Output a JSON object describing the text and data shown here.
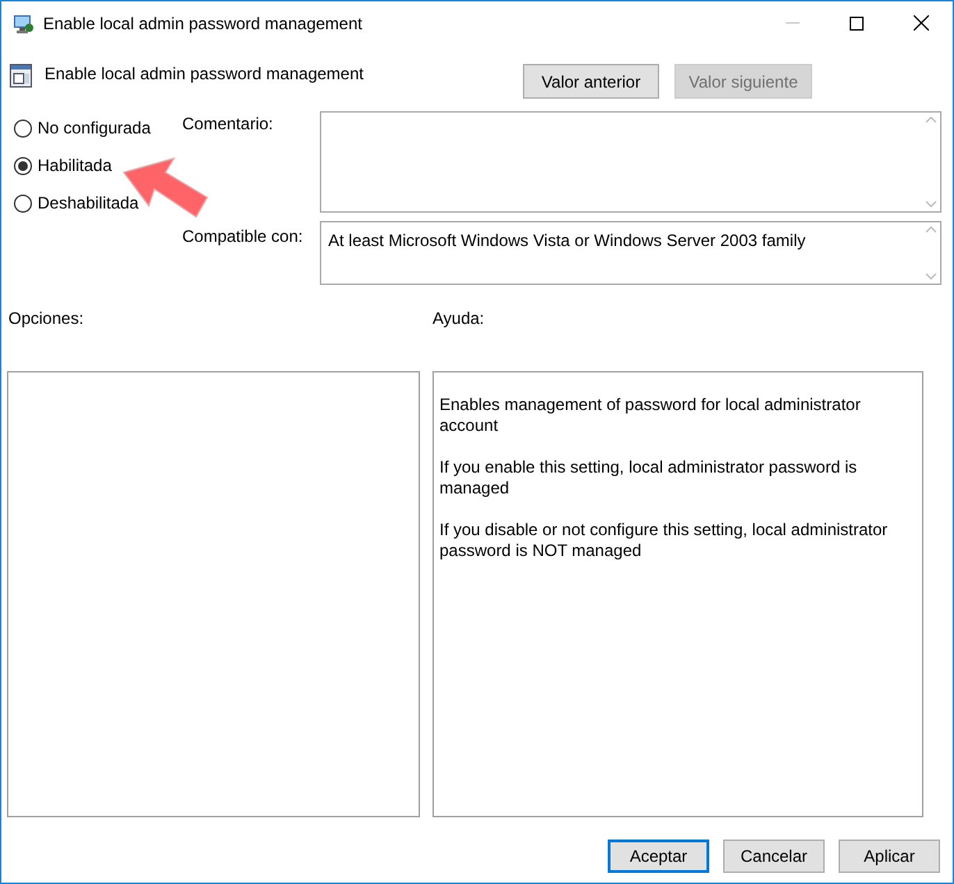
{
  "window": {
    "title": "Enable local admin password management"
  },
  "header": {
    "title": "Enable local admin password management",
    "buttons": [
      {
        "label": "Valor anterior",
        "disabled": false
      },
      {
        "label": "Valor siguiente",
        "disabled": true
      }
    ]
  },
  "state_options": [
    {
      "label": "No configurada",
      "selected": false
    },
    {
      "label": "Habilitada",
      "selected": true
    },
    {
      "label": "Deshabilitada",
      "selected": false
    }
  ],
  "comment": {
    "label": "Comentario:"
  },
  "supported_on": {
    "label": "Compatible con:",
    "value": "At least Microsoft Windows Vista or Windows Server 2003 family"
  },
  "options": {
    "label": "Opciones:"
  },
  "help": {
    "label": "Ayuda:",
    "paragraphs": [
      "Enables management of password for local administrator account",
      "If you enable this setting, local administrator password is managed",
      "If you disable or not configure this setting, local administrator password is NOT managed"
    ]
  },
  "footer_buttons": [
    {
      "label": "Aceptar",
      "default": true
    },
    {
      "label": "Cancelar",
      "default": false
    },
    {
      "label": "Aplicar",
      "default": false
    }
  ]
}
